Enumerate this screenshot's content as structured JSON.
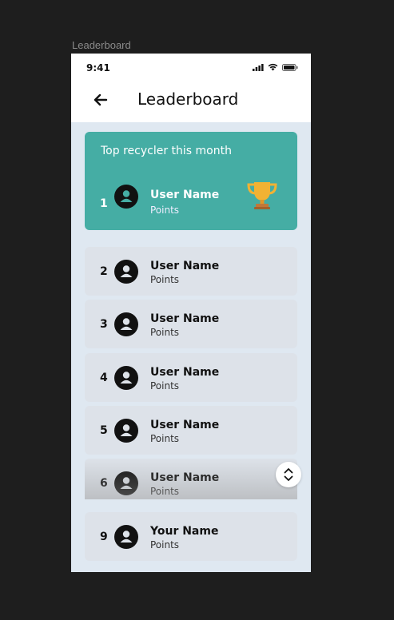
{
  "frame_label": "Leaderboard",
  "status_bar": {
    "time": "9:41"
  },
  "header": {
    "title": "Leaderboard"
  },
  "top_card": {
    "label": "Top recycler this month",
    "rank": "1",
    "name": "User Name",
    "points": "Points"
  },
  "rows": [
    {
      "rank": "2",
      "name": "User Name",
      "points": "Points"
    },
    {
      "rank": "3",
      "name": "User Name",
      "points": "Points"
    },
    {
      "rank": "4",
      "name": "User Name",
      "points": "Points"
    },
    {
      "rank": "5",
      "name": "User Name",
      "points": "Points"
    },
    {
      "rank": "6",
      "name": "User Name",
      "points": "Points"
    }
  ],
  "current_user": {
    "rank": "9",
    "name": "Your Name",
    "points": "Points"
  },
  "colors": {
    "accent": "#45ada4",
    "trophy": "#f2b233",
    "card": "#dde2e9",
    "background": "#dfe8f1"
  }
}
